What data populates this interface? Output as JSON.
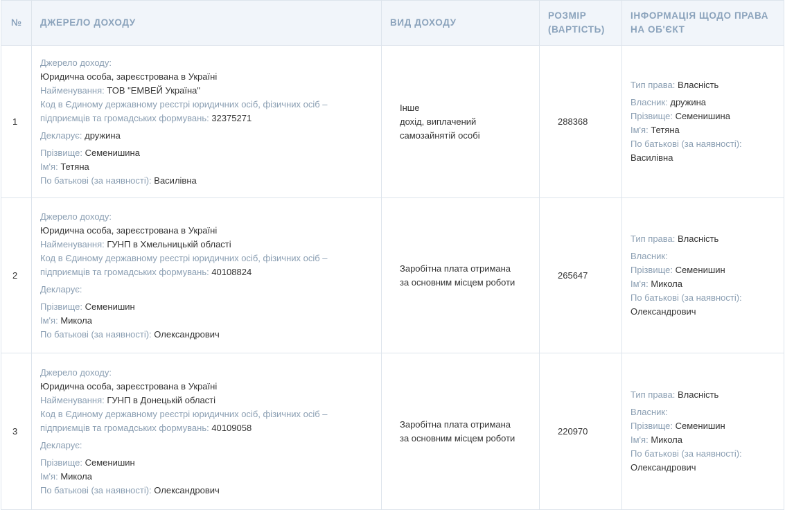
{
  "headers": {
    "num": "№",
    "source": "ДЖЕРЕЛО ДОХОДУ",
    "type": "ВИД ДОХОДУ",
    "amount": "РОЗМІР (ВАРТІСТЬ)",
    "rights": "ІНФОРМАЦІЯ ЩОДО ПРАВА НА ОБ'ЄКТ"
  },
  "labels": {
    "source": "Джерело доходу:",
    "name": "Найменування:",
    "code": "Код в Єдиному державному реєстрі юридичних осіб, фізичних осіб – підприємців та громадських формувань:",
    "declarant": "Декларує:",
    "surname": "Прізвище:",
    "first_name": "Ім'я:",
    "patronymic": "По батькові (за наявності):",
    "right_type": "Тип права:",
    "owner": "Власник:"
  },
  "rows": [
    {
      "num": "1",
      "source_value": "Юридична особа, зареєстрована в Україні",
      "name": "ТОВ \"ЕМВЕЙ Україна\"",
      "code": "32375271",
      "declarant": "дружина",
      "surname": "Семенишина",
      "first_name": "Тетяна",
      "patronymic": "Василівна",
      "income_type_lines": [
        "Інше",
        "дохід, виплачений",
        "самозайнятій особі"
      ],
      "amount": "288368",
      "right_type": "Власність",
      "owner": "дружина",
      "r_surname": "Семенишина",
      "r_first_name": "Тетяна",
      "r_patronymic": "Василівна"
    },
    {
      "num": "2",
      "source_value": "Юридична особа, зареєстрована в Україні",
      "name": "ГУНП в Хмельницькій області",
      "code": "40108824",
      "declarant": "",
      "surname": "Семенишин",
      "first_name": "Микола",
      "patronymic": "Олександрович",
      "income_type_lines": [
        "Заробітна плата отримана",
        "за основним місцем роботи"
      ],
      "amount": "265647",
      "right_type": "Власність",
      "owner": "",
      "r_surname": "Семенишин",
      "r_first_name": "Микола",
      "r_patronymic": "Олександрович"
    },
    {
      "num": "3",
      "source_value": "Юридична особа, зареєстрована в Україні",
      "name": "ГУНП в Донецькій області",
      "code": "40109058",
      "declarant": "",
      "surname": "Семенишин",
      "first_name": "Микола",
      "patronymic": "Олександрович",
      "income_type_lines": [
        "Заробітна плата отримана",
        "за основним місцем роботи"
      ],
      "amount": "220970",
      "right_type": "Власність",
      "owner": "",
      "r_surname": "Семенишин",
      "r_first_name": "Микола",
      "r_patronymic": "Олександрович"
    }
  ]
}
